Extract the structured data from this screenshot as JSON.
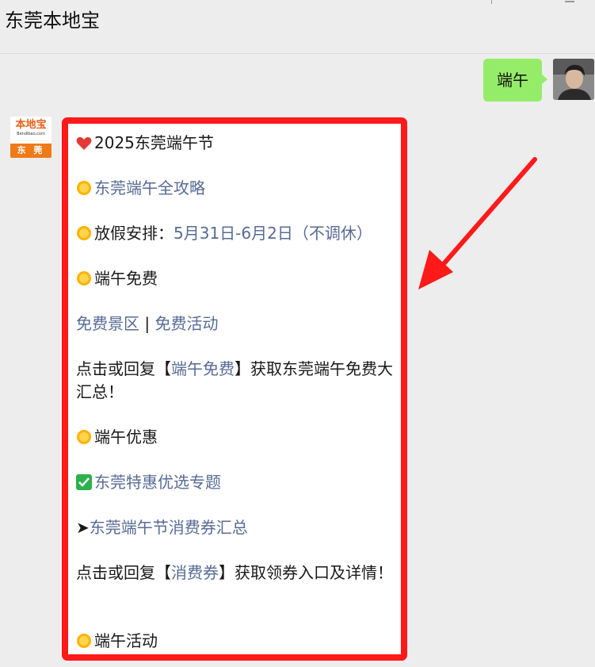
{
  "header": {
    "title": "东莞本地宝"
  },
  "user_message": {
    "text": "端午"
  },
  "bot_avatar": {
    "logo_text": "本地宝",
    "logo_sub": "Bendibao.com",
    "band_text": "东 莞"
  },
  "colors": {
    "link": "#576b95",
    "my_bubble": "#95ec69",
    "highlight_border": "#ff1a1a",
    "arrow": "#ff1a1a"
  },
  "bot_message": {
    "line1": {
      "icon": "heart-icon",
      "text": "2025东莞端午节"
    },
    "line2": {
      "icon": "sun-icon",
      "link": "东莞端午全攻略"
    },
    "line3": {
      "icon": "sun-icon",
      "label": "放假安排：",
      "link": "5月31日-6月2日（不调休）"
    },
    "line4": {
      "icon": "sun-icon",
      "text": "端午免费"
    },
    "line5": {
      "link1": "免费景区",
      "sep": " | ",
      "link2": "免费活动"
    },
    "line6": {
      "pre": "点击或回复【",
      "link": "端午免费",
      "post": "】获取东莞端午免费大汇总！"
    },
    "line7": {
      "icon": "sun-icon",
      "text": "端午优惠"
    },
    "line8": {
      "icon": "check-icon",
      "link": "东莞特惠优选专题"
    },
    "line9": {
      "icon": "arrow-right-icon",
      "prefix": "➤",
      "link": "东莞端午节消费券汇总"
    },
    "line10": {
      "pre": "点击或回复【",
      "link": "消费券",
      "post": "】获取领券入口及详情！"
    },
    "line11": {
      "icon": "sun-icon",
      "text": "端午活动"
    }
  }
}
